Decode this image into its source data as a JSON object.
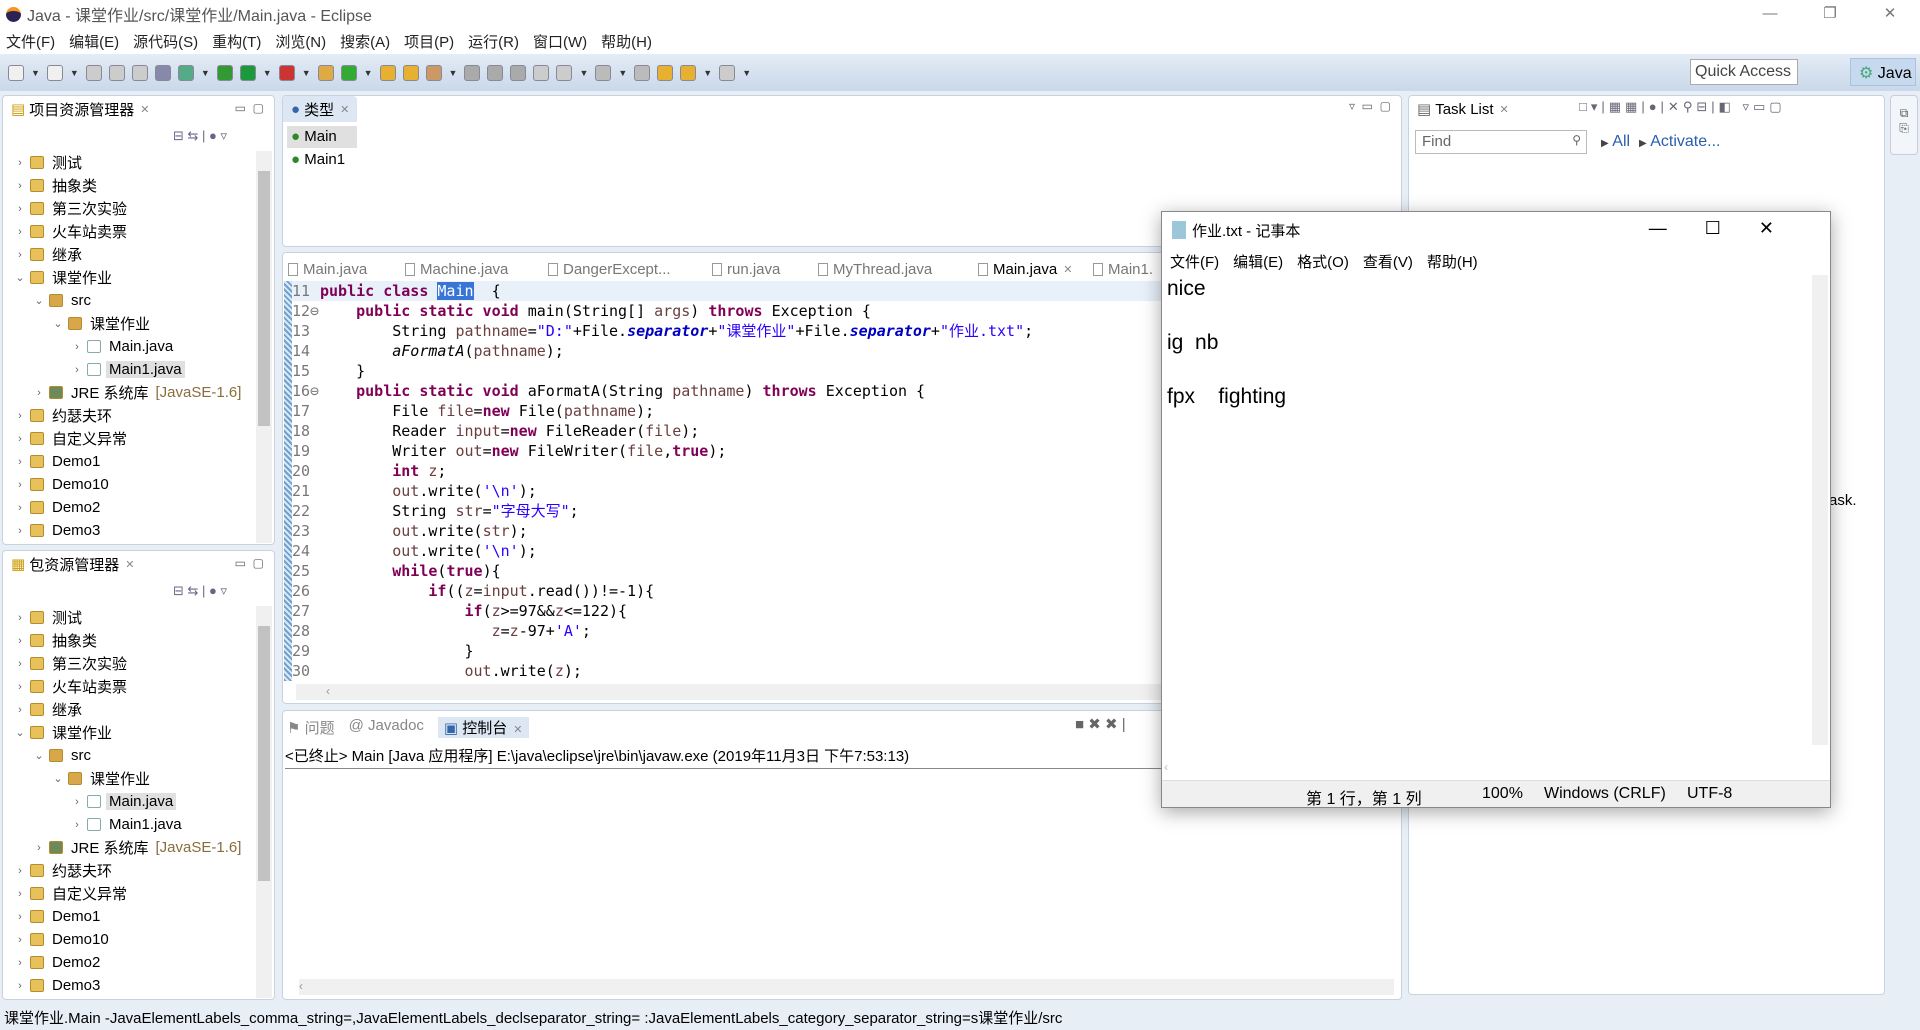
{
  "window": {
    "title": "Java - 课堂作业/src/课堂作业/Main.java - Eclipse",
    "min": "—",
    "max": "❐",
    "close": "✕"
  },
  "menu": [
    "文件(F)",
    "编辑(E)",
    "源代码(S)",
    "重构(T)",
    "浏览(N)",
    "搜索(A)",
    "项目(P)",
    "运行(R)",
    "窗口(W)",
    "帮助(H)"
  ],
  "toolbar": {
    "quick_access": "Quick Access",
    "perspective": "Java"
  },
  "project_explorer": {
    "title": "项目资源管理器",
    "items": [
      {
        "label": "测试",
        "level": 0,
        "state": "collapsed",
        "icon": "project"
      },
      {
        "label": "抽象类",
        "level": 0,
        "state": "collapsed",
        "icon": "project"
      },
      {
        "label": "第三次实验",
        "level": 0,
        "state": "collapsed",
        "icon": "project"
      },
      {
        "label": "火车站卖票",
        "level": 0,
        "state": "collapsed",
        "icon": "project"
      },
      {
        "label": "继承",
        "level": 0,
        "state": "collapsed",
        "icon": "project"
      },
      {
        "label": "课堂作业",
        "level": 0,
        "state": "expanded",
        "icon": "project"
      },
      {
        "label": "src",
        "level": 1,
        "state": "expanded",
        "icon": "src"
      },
      {
        "label": "课堂作业",
        "level": 2,
        "state": "expanded",
        "icon": "package"
      },
      {
        "label": "Main.java",
        "level": 3,
        "state": "collapsed",
        "icon": "java"
      },
      {
        "label": "Main1.java",
        "level": 3,
        "state": "collapsed",
        "icon": "java",
        "selected": true
      },
      {
        "label": "JRE 系统库",
        "suffix": "[JavaSE-1.6]",
        "level": 1,
        "state": "collapsed",
        "icon": "jre"
      },
      {
        "label": "约瑟夫环",
        "level": 0,
        "state": "collapsed",
        "icon": "project"
      },
      {
        "label": "自定义异常",
        "level": 0,
        "state": "collapsed",
        "icon": "project"
      },
      {
        "label": "Demo1",
        "level": 0,
        "state": "collapsed",
        "icon": "project"
      },
      {
        "label": "Demo10",
        "level": 0,
        "state": "collapsed",
        "icon": "project"
      },
      {
        "label": "Demo2",
        "level": 0,
        "state": "collapsed",
        "icon": "project"
      },
      {
        "label": "Demo3",
        "level": 0,
        "state": "collapsed",
        "icon": "project"
      }
    ]
  },
  "package_explorer": {
    "title": "包资源管理器",
    "items": [
      {
        "label": "测试",
        "level": 0,
        "state": "collapsed",
        "icon": "project"
      },
      {
        "label": "抽象类",
        "level": 0,
        "state": "collapsed",
        "icon": "project"
      },
      {
        "label": "第三次实验",
        "level": 0,
        "state": "collapsed",
        "icon": "project"
      },
      {
        "label": "火车站卖票",
        "level": 0,
        "state": "collapsed",
        "icon": "project"
      },
      {
        "label": "继承",
        "level": 0,
        "state": "collapsed",
        "icon": "project"
      },
      {
        "label": "课堂作业",
        "level": 0,
        "state": "expanded",
        "icon": "project"
      },
      {
        "label": "src",
        "level": 1,
        "state": "expanded",
        "icon": "src"
      },
      {
        "label": "课堂作业",
        "level": 2,
        "state": "expanded",
        "icon": "package"
      },
      {
        "label": "Main.java",
        "level": 3,
        "state": "collapsed",
        "icon": "java",
        "selected": true
      },
      {
        "label": "Main1.java",
        "level": 3,
        "state": "collapsed",
        "icon": "java"
      },
      {
        "label": "JRE 系统库",
        "suffix": "[JavaSE-1.6]",
        "level": 1,
        "state": "collapsed",
        "icon": "jre"
      },
      {
        "label": "约瑟夫环",
        "level": 0,
        "state": "collapsed",
        "icon": "project"
      },
      {
        "label": "自定义异常",
        "level": 0,
        "state": "collapsed",
        "icon": "project"
      },
      {
        "label": "Demo1",
        "level": 0,
        "state": "collapsed",
        "icon": "project"
      },
      {
        "label": "Demo10",
        "level": 0,
        "state": "collapsed",
        "icon": "project"
      },
      {
        "label": "Demo2",
        "level": 0,
        "state": "collapsed",
        "icon": "project"
      },
      {
        "label": "Demo3",
        "level": 0,
        "state": "collapsed",
        "icon": "project"
      }
    ]
  },
  "type_hierarchy": {
    "title": "类型",
    "items": [
      "Main",
      "Main1"
    ]
  },
  "editor": {
    "tabs": [
      "Main.java",
      "Machine.java",
      "DangerExcept...",
      "run.java",
      "MyThread.java",
      "Main.java",
      "Main1."
    ],
    "active_tab": 5,
    "lines": [
      {
        "n": "11",
        "t": [
          [
            "kw",
            "public class "
          ],
          [
            "hl",
            "Main"
          ],
          [
            "",
            "  {"
          ]
        ]
      },
      {
        "n": "12⊖",
        "t": [
          [
            "",
            "    "
          ],
          [
            "kw",
            "public static void "
          ],
          [
            "",
            "main(String[] "
          ],
          [
            "var",
            "args"
          ],
          [
            "",
            ") "
          ],
          [
            "kw",
            "throws "
          ],
          [
            "",
            "Exception {"
          ]
        ]
      },
      {
        "n": "13",
        "t": [
          [
            "",
            "        String "
          ],
          [
            "var",
            "pathname"
          ],
          [
            "",
            "="
          ],
          [
            "str",
            "\"D:\""
          ],
          [
            "",
            "+File."
          ],
          [
            "fld",
            "separator"
          ],
          [
            "",
            "+"
          ],
          [
            "str",
            "\"课堂作业\""
          ],
          [
            "",
            "+File."
          ],
          [
            "fld",
            "separator"
          ],
          [
            "",
            "+"
          ],
          [
            "str",
            "\"作业.txt\""
          ],
          [
            "",
            ";"
          ]
        ]
      },
      {
        "n": "14",
        "t": [
          [
            "",
            "        "
          ],
          [
            "mth",
            "aFormatA"
          ],
          [
            "",
            "("
          ],
          [
            "var",
            "pathname"
          ],
          [
            "",
            ");"
          ]
        ]
      },
      {
        "n": "15",
        "t": [
          [
            "",
            "    }"
          ]
        ]
      },
      {
        "n": "16⊖",
        "t": [
          [
            "",
            "    "
          ],
          [
            "kw",
            "public static void "
          ],
          [
            "",
            "aFormatA(String "
          ],
          [
            "var",
            "pathname"
          ],
          [
            "",
            ") "
          ],
          [
            "kw",
            "throws "
          ],
          [
            "",
            "Exception {"
          ]
        ]
      },
      {
        "n": "17",
        "t": [
          [
            "",
            "        File "
          ],
          [
            "var",
            "file"
          ],
          [
            "",
            "="
          ],
          [
            "kw",
            "new "
          ],
          [
            "",
            "File("
          ],
          [
            "var",
            "pathname"
          ],
          [
            "",
            ");"
          ]
        ]
      },
      {
        "n": "18",
        "t": [
          [
            "",
            "        Reader "
          ],
          [
            "var",
            "input"
          ],
          [
            "",
            "="
          ],
          [
            "kw",
            "new "
          ],
          [
            "",
            "FileReader("
          ],
          [
            "var",
            "file"
          ],
          [
            "",
            ");"
          ]
        ]
      },
      {
        "n": "19",
        "t": [
          [
            "",
            "        Writer "
          ],
          [
            "var",
            "out"
          ],
          [
            "",
            "="
          ],
          [
            "kw",
            "new "
          ],
          [
            "",
            "FileWriter("
          ],
          [
            "var",
            "file"
          ],
          [
            "",
            ","
          ],
          [
            "kw",
            "true"
          ],
          [
            "",
            ");"
          ]
        ]
      },
      {
        "n": "20",
        "t": [
          [
            "",
            "        "
          ],
          [
            "kw",
            "int "
          ],
          [
            "var",
            "z"
          ],
          [
            "",
            ";"
          ]
        ]
      },
      {
        "n": "21",
        "t": [
          [
            "",
            "        "
          ],
          [
            "var",
            "out"
          ],
          [
            "",
            ".write("
          ],
          [
            "str",
            "'\\n'"
          ],
          [
            "",
            ");"
          ]
        ]
      },
      {
        "n": "22",
        "t": [
          [
            "",
            "        String "
          ],
          [
            "var",
            "str"
          ],
          [
            "",
            "="
          ],
          [
            "str",
            "\"字母大写\""
          ],
          [
            "",
            ";"
          ]
        ]
      },
      {
        "n": "23",
        "t": [
          [
            "",
            "        "
          ],
          [
            "var",
            "out"
          ],
          [
            "",
            ".write("
          ],
          [
            "var",
            "str"
          ],
          [
            "",
            ");"
          ]
        ]
      },
      {
        "n": "24",
        "t": [
          [
            "",
            "        "
          ],
          [
            "var",
            "out"
          ],
          [
            "",
            ".write("
          ],
          [
            "str",
            "'\\n'"
          ],
          [
            "",
            ");"
          ]
        ]
      },
      {
        "n": "25",
        "t": [
          [
            "",
            "        "
          ],
          [
            "kw",
            "while"
          ],
          [
            "",
            "("
          ],
          [
            "kw",
            "true"
          ],
          [
            "",
            "){"
          ]
        ]
      },
      {
        "n": "26",
        "t": [
          [
            "",
            "            "
          ],
          [
            "kw",
            "if"
          ],
          [
            "",
            "(("
          ],
          [
            "var",
            "z"
          ],
          [
            "",
            "="
          ],
          [
            "var",
            "input"
          ],
          [
            "",
            ".read())!=-1){"
          ]
        ]
      },
      {
        "n": "27",
        "t": [
          [
            "",
            "                "
          ],
          [
            "kw",
            "if"
          ],
          [
            "",
            "("
          ],
          [
            "var",
            "z"
          ],
          [
            "",
            ">=97&&"
          ],
          [
            "var",
            "z"
          ],
          [
            "",
            "<=122){"
          ]
        ]
      },
      {
        "n": "28",
        "t": [
          [
            "",
            "                   "
          ],
          [
            "var",
            "z"
          ],
          [
            "",
            "="
          ],
          [
            "var",
            "z"
          ],
          [
            "",
            "-97+"
          ],
          [
            "str",
            "'A'"
          ],
          [
            "",
            ";"
          ]
        ]
      },
      {
        "n": "29",
        "t": [
          [
            "",
            "                }"
          ]
        ]
      },
      {
        "n": "30",
        "t": [
          [
            "",
            "                "
          ],
          [
            "var",
            "out"
          ],
          [
            "",
            ".write("
          ],
          [
            "var",
            "z"
          ],
          [
            "",
            ");"
          ]
        ]
      }
    ]
  },
  "console": {
    "tabs": [
      "问题",
      "Javadoc",
      "控制台"
    ],
    "active_tab": 2,
    "header": "<已终止> Main [Java 应用程序] E:\\java\\eclipse\\jre\\bin\\javaw.exe  (2019年11月3日 下午7:53:13)"
  },
  "task_list": {
    "title": "Task List",
    "find_placeholder": "Find",
    "all": "All",
    "activate": "Activate...",
    "fragment": "ask."
  },
  "notepad": {
    "title": "作业.txt - 记事本",
    "menu": [
      "文件(F)",
      "编辑(E)",
      "格式(O)",
      "查看(V)",
      "帮助(H)"
    ],
    "content": "nice\n\nig  nb\n\nfpx    fighting",
    "status": {
      "position": "第 1 行，第 1 列",
      "zoom": "100%",
      "eol": "Windows (CRLF)",
      "encoding": "UTF-8"
    }
  },
  "statusbar": "课堂作业.Main -JavaElementLabels_comma_string=,JavaElementLabels_declseparator_string= :JavaElementLabels_category_separator_string=s课堂作业/src",
  "colors": {
    "keyword": "#7f0055",
    "string": "#2a00ff",
    "field": "#0000c0",
    "selection": "#3875d7",
    "toolbar": "#c9d8ea"
  }
}
